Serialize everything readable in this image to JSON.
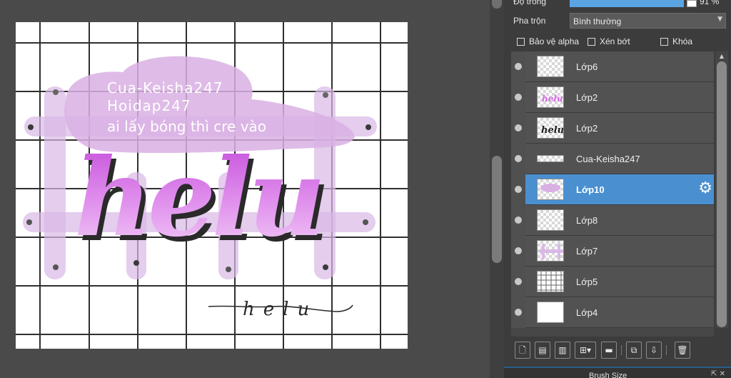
{
  "canvas": {
    "cloud_lines": [
      "Cua-Keisha247",
      "Hoidap247",
      "ai lấy bóng thì cre vào"
    ],
    "main_word": "helu",
    "signature_word": "helu"
  },
  "panel": {
    "opacity_label": "Độ trong",
    "opacity_value": "91 %",
    "opacity_level": 0.91,
    "blend_label": "Pha trộn",
    "blend_value": "Bình thường",
    "checks": [
      {
        "label": "Bảo vệ alpha"
      },
      {
        "label": "Xén bớt"
      },
      {
        "label": "Khóa"
      }
    ],
    "layers": [
      {
        "name": "Lớp6"
      },
      {
        "name": "Lớp2"
      },
      {
        "name": "Lớp2"
      },
      {
        "name": "Cua-Keisha247"
      },
      {
        "name": "Lớp10",
        "selected": true
      },
      {
        "name": "Lớp8"
      },
      {
        "name": "Lớp7"
      },
      {
        "name": "Lớp5"
      },
      {
        "name": "Lớp4"
      }
    ],
    "thumb_texts": [
      "helu",
      "helu"
    ],
    "brush_title": "Brush Size"
  },
  "colors": {
    "accent": "#4a90d0",
    "pink": "#d76be6",
    "lavender": "#d9b8e6"
  }
}
